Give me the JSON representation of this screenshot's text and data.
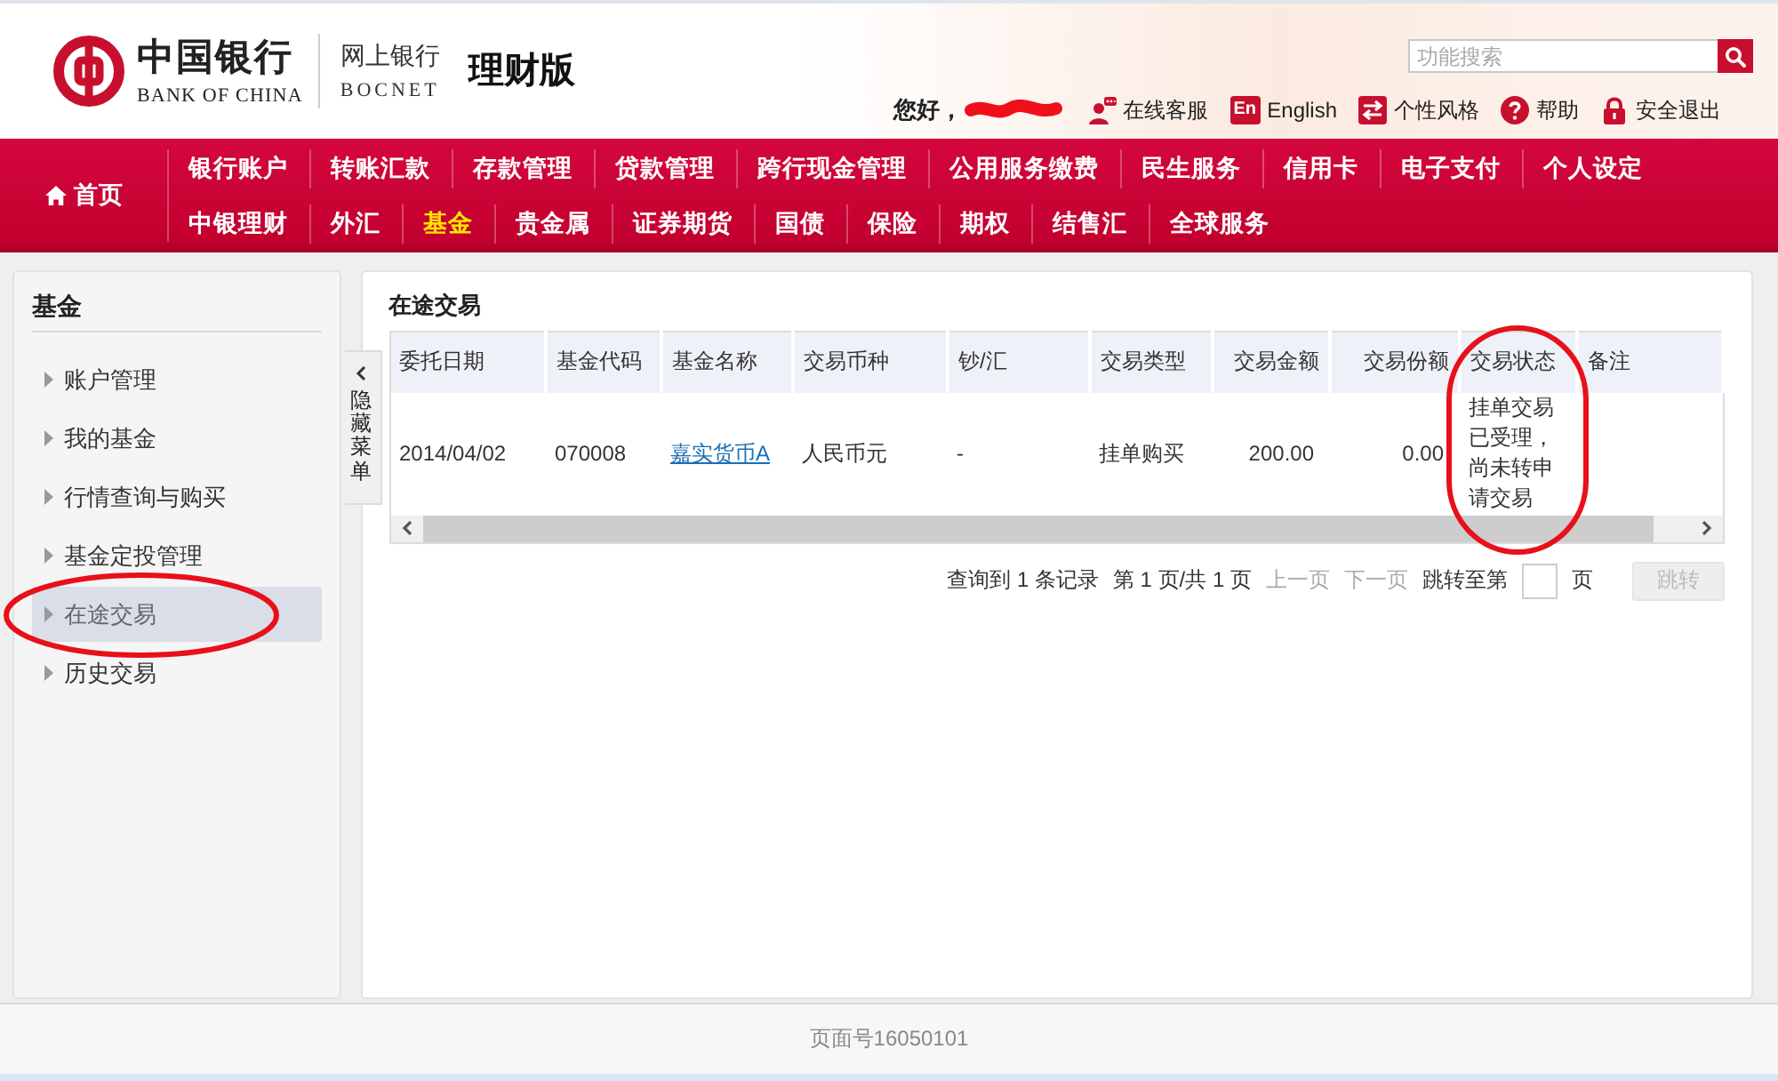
{
  "header": {
    "logo": {
      "name": "中国银行",
      "name_en": "BANK OF CHINA"
    },
    "product": {
      "name": "网上银行",
      "name_en": "BOCNET"
    },
    "edition": "理财版",
    "search": {
      "placeholder": "功能搜索"
    },
    "greeting": "您好，",
    "user_redacted": true,
    "links": [
      {
        "kind": "service",
        "label": "在线客服"
      },
      {
        "kind": "language",
        "badge": "En",
        "label": "English"
      },
      {
        "kind": "style",
        "label": "个性风格"
      },
      {
        "kind": "help",
        "label": "帮助"
      },
      {
        "kind": "logout",
        "label": "安全退出"
      }
    ]
  },
  "nav": {
    "home": "首页",
    "rows": [
      {
        "items": [
          {
            "label": "银行账户",
            "selected": false
          },
          {
            "label": "转账汇款",
            "selected": false
          },
          {
            "label": "存款管理",
            "selected": false
          },
          {
            "label": "贷款管理",
            "selected": false
          },
          {
            "label": "跨行现金管理",
            "selected": false
          },
          {
            "label": "公用服务缴费",
            "selected": false
          },
          {
            "label": "民生服务",
            "selected": false
          },
          {
            "label": "信用卡",
            "selected": false
          },
          {
            "label": "电子支付",
            "selected": false
          },
          {
            "label": "个人设定",
            "selected": false
          }
        ]
      },
      {
        "items": [
          {
            "label": "中银理财",
            "selected": false
          },
          {
            "label": "外汇",
            "selected": false
          },
          {
            "label": "基金",
            "selected": true
          },
          {
            "label": "贵金属",
            "selected": false
          },
          {
            "label": "证券期货",
            "selected": false
          },
          {
            "label": "国债",
            "selected": false
          },
          {
            "label": "保险",
            "selected": false
          },
          {
            "label": "期权",
            "selected": false
          },
          {
            "label": "结售汇",
            "selected": false
          },
          {
            "label": "全球服务",
            "selected": false
          }
        ]
      }
    ]
  },
  "sidebar": {
    "title": "基金",
    "items": [
      {
        "label": "账户管理",
        "selected": false,
        "circled": false
      },
      {
        "label": "我的基金",
        "selected": false,
        "circled": false
      },
      {
        "label": "行情查询与购买",
        "selected": false,
        "circled": false
      },
      {
        "label": "基金定投管理",
        "selected": false,
        "circled": false
      },
      {
        "label": "在途交易",
        "selected": true,
        "circled": true
      },
      {
        "label": "历史交易",
        "selected": false,
        "circled": false
      }
    ],
    "collapse_tab": "隐藏菜单"
  },
  "main": {
    "title": "在途交易",
    "table": {
      "columns": [
        {
          "label": "委托日期",
          "kind": "text",
          "circled": false
        },
        {
          "label": "基金代码",
          "kind": "text",
          "circled": false
        },
        {
          "label": "基金名称",
          "kind": "text",
          "circled": false
        },
        {
          "label": "交易币种",
          "kind": "text",
          "circled": false
        },
        {
          "label": "钞/汇",
          "kind": "text",
          "circled": false
        },
        {
          "label": "交易类型",
          "kind": "text",
          "circled": false
        },
        {
          "label": "交易金额",
          "kind": "amount",
          "circled": false
        },
        {
          "label": "交易份额",
          "kind": "amount",
          "circled": false
        },
        {
          "label": "交易状态",
          "kind": "text",
          "circled": true
        },
        {
          "label": "备注",
          "kind": "text",
          "circled": false
        }
      ],
      "rows": [
        {
          "cells": [
            {
              "kind": "text",
              "text": "2014/04/02"
            },
            {
              "kind": "text",
              "text": "070008"
            },
            {
              "kind": "link",
              "text": "嘉实货币A"
            },
            {
              "kind": "text",
              "text": "人民币元"
            },
            {
              "kind": "text",
              "text": "-"
            },
            {
              "kind": "text",
              "text": "挂单购买"
            },
            {
              "kind": "amount",
              "text": "200.00"
            },
            {
              "kind": "amount",
              "text": "0.00"
            },
            {
              "kind": "text",
              "text": "挂单交易已受理，尚未转申请交易"
            }
          ]
        }
      ]
    },
    "pagination": {
      "summary": "查询到 1 条记录",
      "page_info": "第 1 页/共 1 页",
      "prev": {
        "label": "上一页",
        "disabled": true
      },
      "next": {
        "label": "下一页",
        "disabled": true
      },
      "jump_label": "跳转至第",
      "jump_unit": "页",
      "jump_button": {
        "label": "跳转",
        "disabled": true
      }
    }
  },
  "footer": {
    "page_id": "页面号16050101"
  }
}
